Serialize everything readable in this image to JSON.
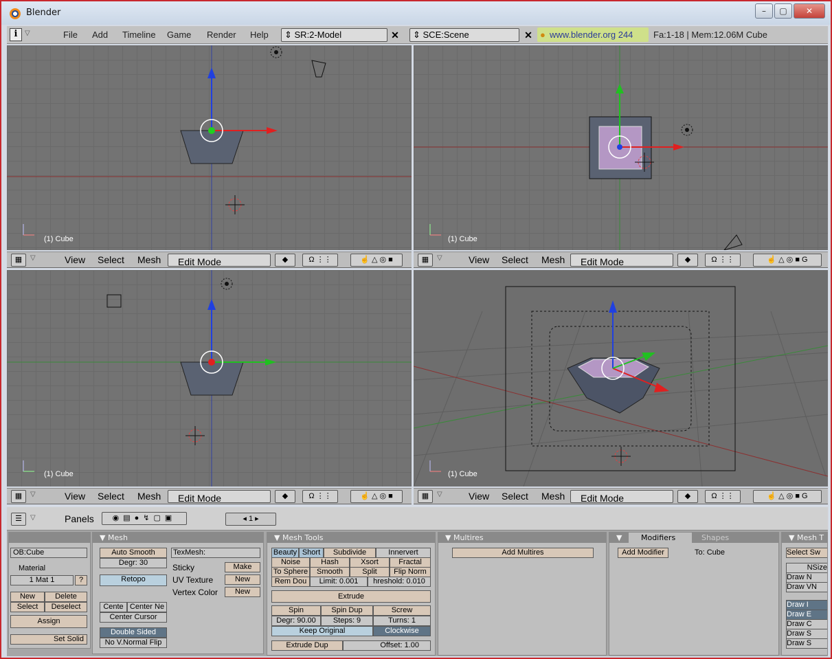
{
  "window": {
    "title": "Blender",
    "controls": [
      "–",
      "▢",
      "✕"
    ]
  },
  "header": {
    "menus": [
      "File",
      "Add",
      "Timeline",
      "Game",
      "Render",
      "Help"
    ],
    "screen": "SR:2-Model",
    "scene": "SCE:Scene",
    "url": "www.blender.org 244",
    "stats": "Fa:1-18 | Mem:12.06M Cube"
  },
  "viewports": [
    {
      "label": "(1) Cube",
      "menus": [
        "View",
        "Select",
        "Mesh"
      ],
      "mode": "Edit Mode"
    },
    {
      "label": "(1) Cube",
      "menus": [
        "View",
        "Select",
        "Mesh"
      ],
      "mode": "Edit Mode"
    },
    {
      "label": "(1) Cube",
      "menus": [
        "View",
        "Select",
        "Mesh"
      ],
      "mode": "Edit Mode"
    },
    {
      "label": "(1) Cube",
      "menus": [
        "View",
        "Select",
        "Mesh"
      ],
      "mode": "Edit Mode"
    }
  ],
  "buttons_header": {
    "panels_label": "Panels",
    "frame": "1"
  },
  "link_panel": {
    "ob": "OB:Cube",
    "material": "Material",
    "mat": "1 Mat 1",
    "q": "?",
    "new": "New",
    "delete": "Delete",
    "select": "Select",
    "deselect": "Deselect",
    "assign": "Assign",
    "set_solid": "Set Solid"
  },
  "mesh_panel": {
    "title": "Mesh",
    "auto_smooth": "Auto Smooth",
    "degr": "Degr: 30",
    "retopo": "Retopo",
    "center": "Cente",
    "center_new": "Center Ne",
    "center_cursor": "Center Cursor",
    "double_sided": "Double Sided",
    "no_flip": "No V.Normal Flip",
    "texmesh": "TexMesh:",
    "sticky": "Sticky",
    "make": "Make",
    "uv_texture": "UV Texture",
    "new1": "New",
    "vertex_color": "Vertex Color",
    "new2": "New"
  },
  "mesh_tools": {
    "title": "Mesh Tools",
    "beauty": "Beauty",
    "short": "Short",
    "subdivide": "Subdivide",
    "innervert": "Innervert",
    "noise": "Noise",
    "hash": "Hash",
    "xsort": "Xsort",
    "fractal": "Fractal",
    "to_sphere": "To Sphere",
    "smooth": "Smooth",
    "split": "Split",
    "flip_norm": "Flip Norm",
    "rem_dou": "Rem Dou",
    "limit": "Limit: 0.001",
    "threshold": "hreshold: 0.010",
    "extrude": "Extrude",
    "spin": "Spin",
    "spin_dup": "Spin Dup",
    "screw": "Screw",
    "degr90": "Degr: 90.00",
    "steps": "Steps: 9",
    "turns": "Turns: 1",
    "keep_original": "Keep Original",
    "clockwise": "Clockwise",
    "extrude_dup": "Extrude Dup",
    "offset": "Offset: 1.00"
  },
  "multires": {
    "title": "Multires",
    "add": "Add Multires"
  },
  "modifiers": {
    "tab1": "Modifiers",
    "tab2": "Shapes",
    "add": "Add Modifier",
    "to": "To: Cube"
  },
  "mesh_tools_more": {
    "title": "Mesh T",
    "select_sw": "Select Sw",
    "nsize": "NSize:",
    "draw_n": "Draw N",
    "draw_vn": "Draw VN",
    "draw1": "Draw I",
    "draw2": "Draw E",
    "draw3": "Draw C",
    "draw4": "Draw S",
    "draw5": "Draw S"
  },
  "colors": {
    "x_axis": "#e02020",
    "y_axis": "#20c020",
    "z_axis": "#2040e0",
    "viewport_bg": "#737373"
  }
}
